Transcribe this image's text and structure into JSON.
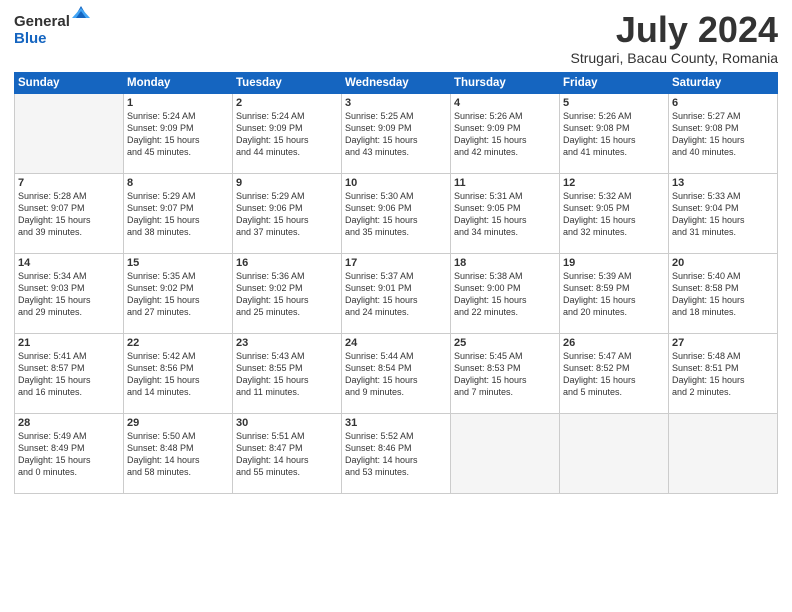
{
  "logo": {
    "general": "General",
    "blue": "Blue"
  },
  "header": {
    "month": "July 2024",
    "location": "Strugari, Bacau County, Romania"
  },
  "weekdays": [
    "Sunday",
    "Monday",
    "Tuesday",
    "Wednesday",
    "Thursday",
    "Friday",
    "Saturday"
  ],
  "weeks": [
    [
      {
        "day": "",
        "info": ""
      },
      {
        "day": "1",
        "info": "Sunrise: 5:24 AM\nSunset: 9:09 PM\nDaylight: 15 hours\nand 45 minutes."
      },
      {
        "day": "2",
        "info": "Sunrise: 5:24 AM\nSunset: 9:09 PM\nDaylight: 15 hours\nand 44 minutes."
      },
      {
        "day": "3",
        "info": "Sunrise: 5:25 AM\nSunset: 9:09 PM\nDaylight: 15 hours\nand 43 minutes."
      },
      {
        "day": "4",
        "info": "Sunrise: 5:26 AM\nSunset: 9:09 PM\nDaylight: 15 hours\nand 42 minutes."
      },
      {
        "day": "5",
        "info": "Sunrise: 5:26 AM\nSunset: 9:08 PM\nDaylight: 15 hours\nand 41 minutes."
      },
      {
        "day": "6",
        "info": "Sunrise: 5:27 AM\nSunset: 9:08 PM\nDaylight: 15 hours\nand 40 minutes."
      }
    ],
    [
      {
        "day": "7",
        "info": "Sunrise: 5:28 AM\nSunset: 9:07 PM\nDaylight: 15 hours\nand 39 minutes."
      },
      {
        "day": "8",
        "info": "Sunrise: 5:29 AM\nSunset: 9:07 PM\nDaylight: 15 hours\nand 38 minutes."
      },
      {
        "day": "9",
        "info": "Sunrise: 5:29 AM\nSunset: 9:06 PM\nDaylight: 15 hours\nand 37 minutes."
      },
      {
        "day": "10",
        "info": "Sunrise: 5:30 AM\nSunset: 9:06 PM\nDaylight: 15 hours\nand 35 minutes."
      },
      {
        "day": "11",
        "info": "Sunrise: 5:31 AM\nSunset: 9:05 PM\nDaylight: 15 hours\nand 34 minutes."
      },
      {
        "day": "12",
        "info": "Sunrise: 5:32 AM\nSunset: 9:05 PM\nDaylight: 15 hours\nand 32 minutes."
      },
      {
        "day": "13",
        "info": "Sunrise: 5:33 AM\nSunset: 9:04 PM\nDaylight: 15 hours\nand 31 minutes."
      }
    ],
    [
      {
        "day": "14",
        "info": "Sunrise: 5:34 AM\nSunset: 9:03 PM\nDaylight: 15 hours\nand 29 minutes."
      },
      {
        "day": "15",
        "info": "Sunrise: 5:35 AM\nSunset: 9:02 PM\nDaylight: 15 hours\nand 27 minutes."
      },
      {
        "day": "16",
        "info": "Sunrise: 5:36 AM\nSunset: 9:02 PM\nDaylight: 15 hours\nand 25 minutes."
      },
      {
        "day": "17",
        "info": "Sunrise: 5:37 AM\nSunset: 9:01 PM\nDaylight: 15 hours\nand 24 minutes."
      },
      {
        "day": "18",
        "info": "Sunrise: 5:38 AM\nSunset: 9:00 PM\nDaylight: 15 hours\nand 22 minutes."
      },
      {
        "day": "19",
        "info": "Sunrise: 5:39 AM\nSunset: 8:59 PM\nDaylight: 15 hours\nand 20 minutes."
      },
      {
        "day": "20",
        "info": "Sunrise: 5:40 AM\nSunset: 8:58 PM\nDaylight: 15 hours\nand 18 minutes."
      }
    ],
    [
      {
        "day": "21",
        "info": "Sunrise: 5:41 AM\nSunset: 8:57 PM\nDaylight: 15 hours\nand 16 minutes."
      },
      {
        "day": "22",
        "info": "Sunrise: 5:42 AM\nSunset: 8:56 PM\nDaylight: 15 hours\nand 14 minutes."
      },
      {
        "day": "23",
        "info": "Sunrise: 5:43 AM\nSunset: 8:55 PM\nDaylight: 15 hours\nand 11 minutes."
      },
      {
        "day": "24",
        "info": "Sunrise: 5:44 AM\nSunset: 8:54 PM\nDaylight: 15 hours\nand 9 minutes."
      },
      {
        "day": "25",
        "info": "Sunrise: 5:45 AM\nSunset: 8:53 PM\nDaylight: 15 hours\nand 7 minutes."
      },
      {
        "day": "26",
        "info": "Sunrise: 5:47 AM\nSunset: 8:52 PM\nDaylight: 15 hours\nand 5 minutes."
      },
      {
        "day": "27",
        "info": "Sunrise: 5:48 AM\nSunset: 8:51 PM\nDaylight: 15 hours\nand 2 minutes."
      }
    ],
    [
      {
        "day": "28",
        "info": "Sunrise: 5:49 AM\nSunset: 8:49 PM\nDaylight: 15 hours\nand 0 minutes."
      },
      {
        "day": "29",
        "info": "Sunrise: 5:50 AM\nSunset: 8:48 PM\nDaylight: 14 hours\nand 58 minutes."
      },
      {
        "day": "30",
        "info": "Sunrise: 5:51 AM\nSunset: 8:47 PM\nDaylight: 14 hours\nand 55 minutes."
      },
      {
        "day": "31",
        "info": "Sunrise: 5:52 AM\nSunset: 8:46 PM\nDaylight: 14 hours\nand 53 minutes."
      },
      {
        "day": "",
        "info": ""
      },
      {
        "day": "",
        "info": ""
      },
      {
        "day": "",
        "info": ""
      }
    ]
  ]
}
